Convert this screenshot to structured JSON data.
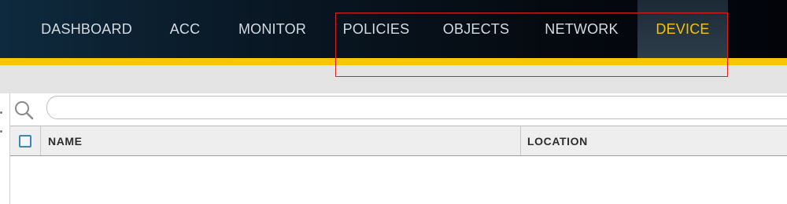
{
  "nav": {
    "tabs": [
      {
        "label": "DASHBOARD",
        "active": false
      },
      {
        "label": "ACC",
        "active": false
      },
      {
        "label": "MONITOR",
        "active": false
      },
      {
        "label": "POLICIES",
        "active": false
      },
      {
        "label": "OBJECTS",
        "active": false
      },
      {
        "label": "NETWORK",
        "active": false
      },
      {
        "label": "DEVICE",
        "active": true
      }
    ]
  },
  "search": {
    "value": "",
    "placeholder": "",
    "icon": "search-icon"
  },
  "table": {
    "columns": [
      "NAME",
      "LOCATION"
    ],
    "rows": []
  },
  "colors": {
    "nav_background": "#050a10",
    "accent": "#f7c600",
    "active_tab_text": "#f4c400",
    "tab_text": "#d5dbe1",
    "highlight_box": "#e02020"
  }
}
